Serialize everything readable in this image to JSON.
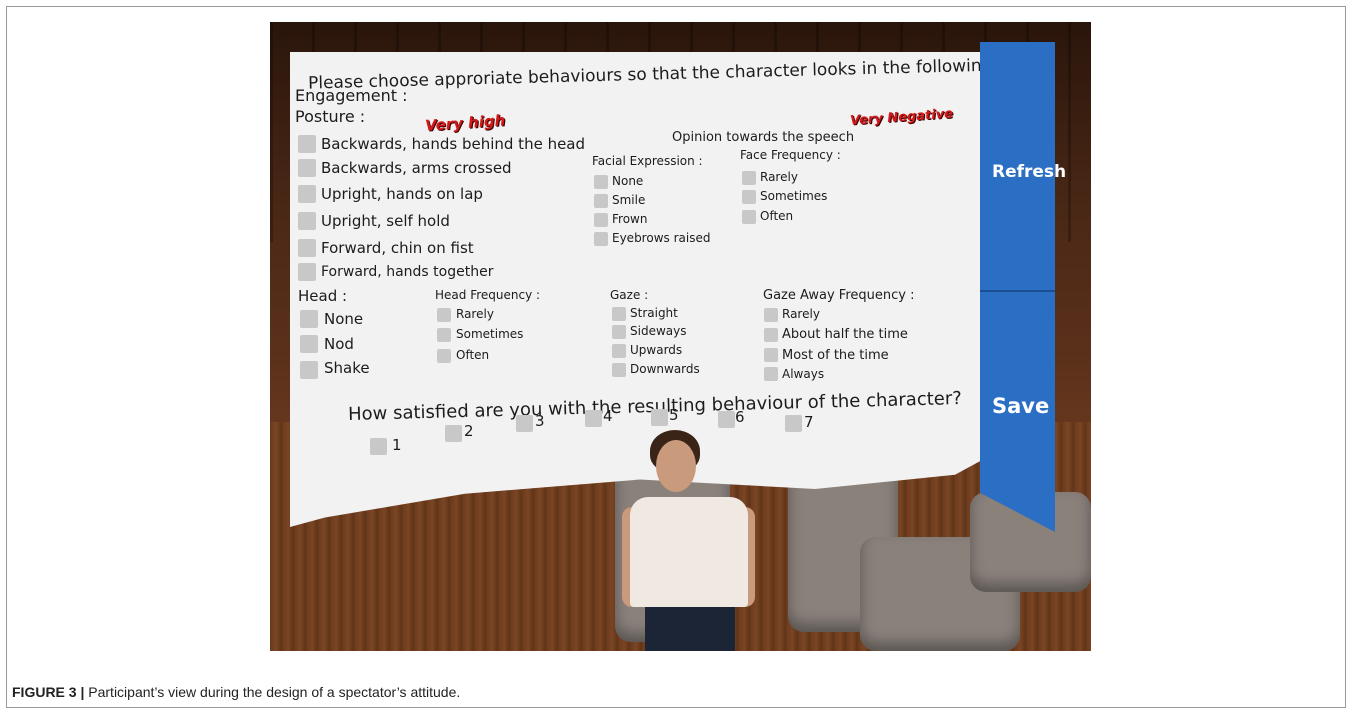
{
  "panel": {
    "title": "Please choose approriate behaviours so that the character looks in the following state",
    "engagement_label": "Engagement :",
    "engagement_value": "Very high",
    "opinion_label": "Opinion towards the speech",
    "opinion_value": "Very Negative",
    "posture": {
      "label": "Posture :",
      "options": [
        "Backwards, hands behind the head",
        "Backwards, arms crossed",
        "Upright, hands on lap",
        "Upright, self hold",
        "Forward, chin on fist",
        "Forward, hands together"
      ]
    },
    "facial_expression": {
      "label": "Facial Expression :",
      "options": [
        "None",
        "Smile",
        "Frown",
        "Eyebrows raised"
      ]
    },
    "face_frequency": {
      "label": "Face Frequency :",
      "options": [
        "Rarely",
        "Sometimes",
        "Often"
      ]
    },
    "head": {
      "label": "Head :",
      "options": [
        "None",
        "Nod",
        "Shake"
      ]
    },
    "head_frequency": {
      "label": "Head Frequency :",
      "options": [
        "Rarely",
        "Sometimes",
        "Often"
      ]
    },
    "gaze": {
      "label": "Gaze :",
      "options": [
        "Straight",
        "Sideways",
        "Upwards",
        "Downwards"
      ]
    },
    "gaze_away_frequency": {
      "label": "Gaze Away Frequency :",
      "options": [
        "Rarely",
        "About half the time",
        "Most of the time",
        "Always"
      ]
    },
    "satisfaction": {
      "question": "How satisfied are you with the resulting behaviour of the character?",
      "options": [
        "1",
        "2",
        "3",
        "4",
        "5",
        "6",
        "7"
      ]
    }
  },
  "side": {
    "refresh_label": "Refresh",
    "save_label": "Save"
  },
  "caption": {
    "label": "FIGURE 3 |",
    "text": "Participant’s view during the design of a spectator’s attitude."
  },
  "colors": {
    "accent": "#2a6fc4",
    "badge": "#d31a1a"
  }
}
